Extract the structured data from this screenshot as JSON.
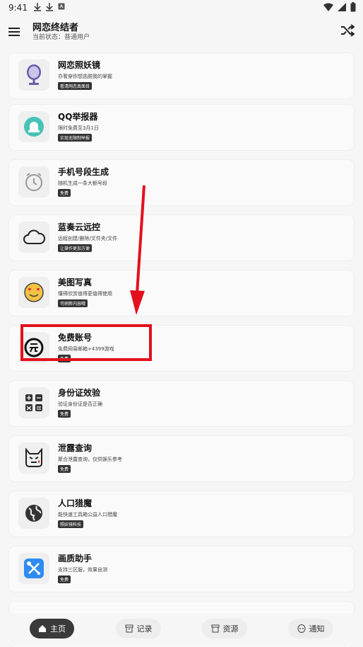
{
  "status_bar": {
    "time": "9:41"
  },
  "app_bar": {
    "title": "网恋终结者",
    "subtitle": "当前状态：普通用户"
  },
  "cards": [
    {
      "name": "网恋照妖镜",
      "desc": "亦看穿你想逃脱我的掌握",
      "tag": "看清网恋真面目",
      "icon": "mirror-icon"
    },
    {
      "name": "QQ举报器",
      "desc": "限时免费至3月1日",
      "tag": "实现无限制举报",
      "icon": "siren-icon"
    },
    {
      "name": "手机号段生成",
      "desc": "随机生成一条大额号段",
      "tag": "免费",
      "icon": "clock-icon"
    },
    {
      "name": "蓝奏云远控",
      "desc": "远程创建/删除/文件夹/文件",
      "tag": "让操作更加方便",
      "icon": "cloud-icon"
    },
    {
      "name": "美图写真",
      "desc": "懂得欣赏值得更值得使用",
      "tag": "可刷新内容哦",
      "icon": "emoji-heart-eyes-icon"
    },
    {
      "name": "免费账号",
      "desc": "免费网易邮箱+4399游戏",
      "tag": "免费",
      "icon": "free-badge-icon"
    },
    {
      "name": "身份证效验",
      "desc": "验证身份证是否正确",
      "tag": "免费",
      "icon": "calculator-icon"
    },
    {
      "name": "泄露查询",
      "desc": "聚合泄露查询，仅供娱乐参考",
      "tag": "免费",
      "icon": "devil-icon"
    },
    {
      "name": "人口猎魔",
      "desc": "能快速工具箱公益人口猎魔",
      "tag": "照妖镜科技",
      "icon": "globe-icon"
    },
    {
      "name": "画质助手",
      "desc": "支持三区服，效果自测",
      "tag": "免费",
      "icon": "tools-icon"
    }
  ],
  "bottom_nav": [
    {
      "label": "主页",
      "icon": "home-icon",
      "active": true
    },
    {
      "label": "记录",
      "icon": "archive-icon",
      "active": false
    },
    {
      "label": "资源",
      "icon": "box-icon",
      "active": false
    },
    {
      "label": "通知",
      "icon": "alien-icon",
      "active": false
    }
  ],
  "colors": {
    "annotation": "#e3101e",
    "nav_active": "#3a3a3a",
    "background": "#f6f6f6"
  }
}
